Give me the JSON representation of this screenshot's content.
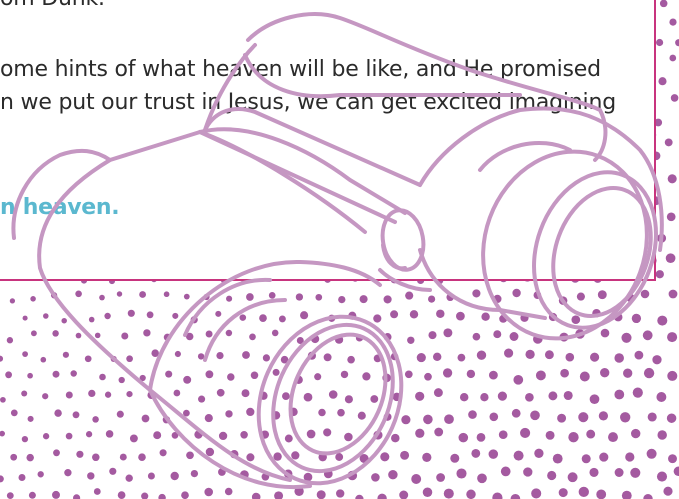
{
  "document": {
    "line_top": "om Dunk.",
    "line_1": "ome hints of what heaven will be like, and He promised",
    "line_2": "n we put our trust in Jesus, we can get excited imagining",
    "highlight": "n heaven."
  },
  "colors": {
    "frame": "#c8347e",
    "body_text": "#2b2b2b",
    "highlight_text": "#5bb8cf",
    "illustration_stroke": "#c597c2",
    "dots": "#a45aa0"
  },
  "illustration": {
    "icon": "binoculars-icon"
  }
}
